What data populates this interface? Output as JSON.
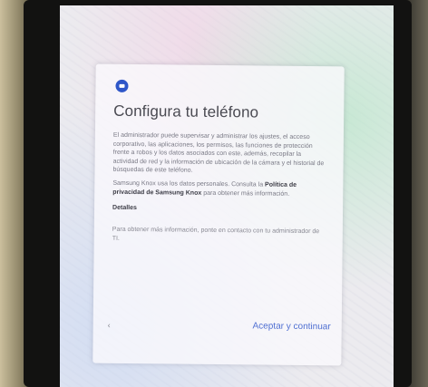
{
  "setup": {
    "title": "Configura tu teléfono",
    "paragraph_1": "El administrador puede supervisar y administrar los ajustes, el acceso corporativo, las aplicaciones, los permisos, las funciones de protección frente a robos y los datos asociados con este, además, recopilar la actividad de red y la información de ubicación de la cámara y el historial de búsquedas de este teléfono.",
    "paragraph_2_start": "Samsung Knox usa los datos personales. Consulta la ",
    "privacy_link": "Política de privacidad de Samsung Knox",
    "paragraph_2_end": " para obtener más información.",
    "details_label": "Detalles",
    "paragraph_3": "Para obtener más información, ponte en contacto con tu administrador de TI.",
    "back_label": "‹",
    "accept_label": "Aceptar y continuar"
  },
  "icons": {
    "header": "briefcase-icon"
  },
  "colors": {
    "accent": "#4f6fd2",
    "icon_blue": "#2e56c8"
  }
}
